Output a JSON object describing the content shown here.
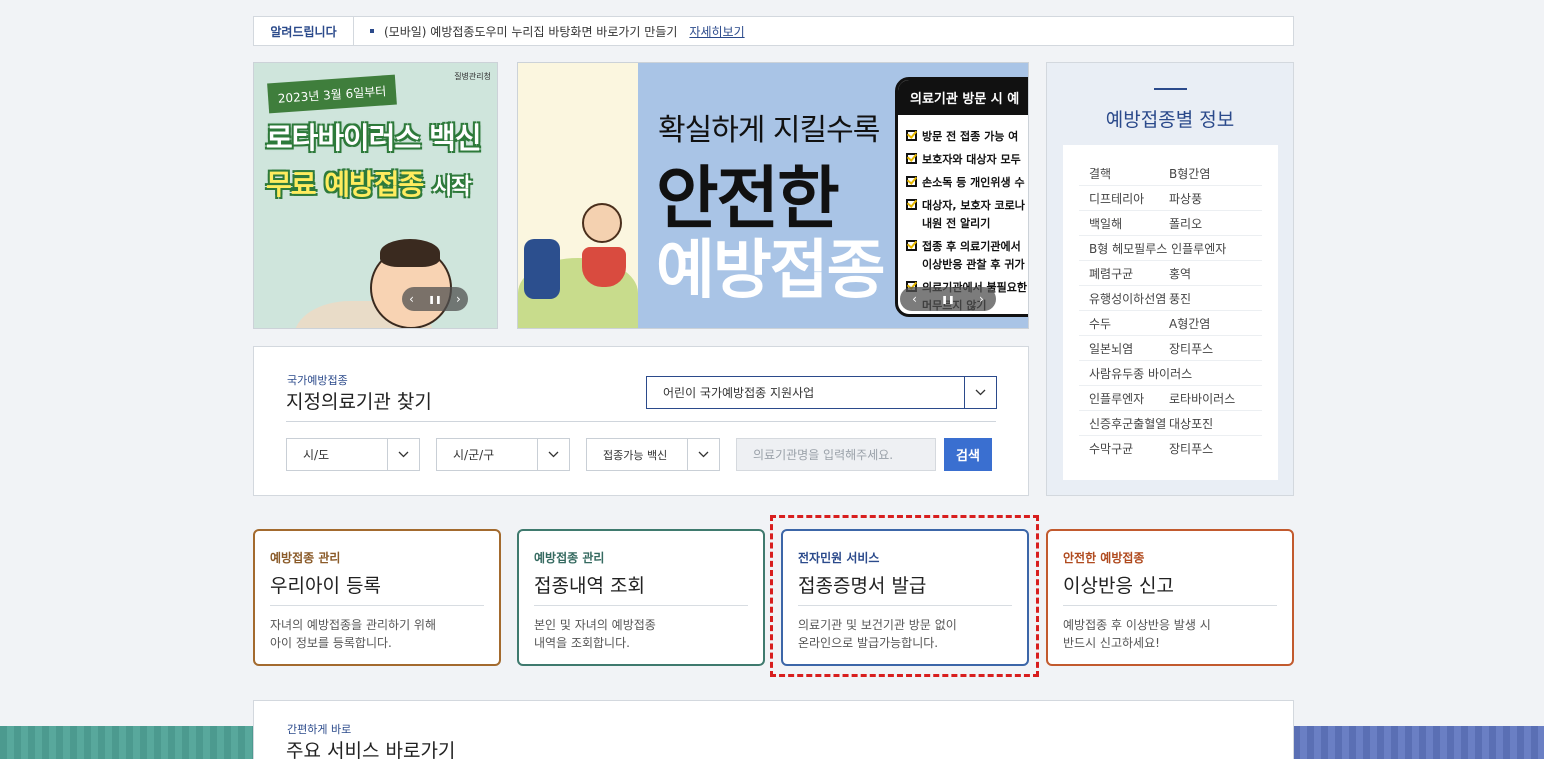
{
  "notice": {
    "label": "알려드립니다",
    "text": "(모바일) 예방접종도우미 누리집 바탕화면 바로가기 만들기",
    "link": "자세히보기"
  },
  "banner_rotavirus": {
    "date_flag": "2023년 3월 6일부터",
    "ministry": "질병관리청",
    "line1": "로타바이러스 백신",
    "line2_main": "무료 예방접종",
    "line2_tail": "시작",
    "controls": {
      "prev": "‹",
      "pause": "❚❚",
      "next": "›"
    }
  },
  "banner_safe": {
    "line1": "확실하게 지킬수록",
    "line2": "안전한",
    "line3": "예방접종",
    "panel_title": "의료기관 방문 시 예",
    "checklist": [
      "방문 전 접종 가능 여",
      "보호자와 대상자 모두",
      "손소독 등 개인위생 수",
      "대상자, 보호자 코로나",
      "내원 전 알리기",
      "접종 후 의료기관에서",
      "이상반응 관찰 후 귀가",
      "의료기관에서 불필요한",
      "머무르지 않기"
    ],
    "controls": {
      "prev": "‹",
      "pause": "❚❚",
      "next": "›"
    }
  },
  "vaccine_info": {
    "title": "예방접종별 정보",
    "rows": [
      [
        "결핵",
        "B형간염"
      ],
      [
        "디프테리아",
        "파상풍"
      ],
      [
        "백일해",
        "폴리오"
      ],
      [
        "B형 헤모필루스 인플루엔자",
        ""
      ],
      [
        "폐렴구균",
        "홍역"
      ],
      [
        "유행성이하선염",
        "풍진"
      ],
      [
        "수두",
        "A형간염"
      ],
      [
        "일본뇌염",
        "장티푸스"
      ],
      [
        "사람유두종 바이러스",
        ""
      ],
      [
        "인플루엔자",
        "로타바이러스"
      ],
      [
        "신증후군출혈열",
        "대상포진"
      ],
      [
        "수막구균",
        "장티푸스"
      ]
    ]
  },
  "search": {
    "subtitle": "국가예방접종",
    "title": "지정의료기관 찾기",
    "program_select": "어린이 국가예방접종 지원사업",
    "sido_select": "시/도",
    "sigungu_select": "시/군/구",
    "vaccine_select": "접종가능 백신",
    "input_placeholder": "의료기관명을 입력해주세요.",
    "button": "검색"
  },
  "cards": [
    {
      "category": "예방접종 관리",
      "title": "우리아이 등록",
      "desc1": "자녀의 예방접종을 관리하기 위해",
      "desc2": "아이 정보를 등록합니다."
    },
    {
      "category": "예방접종 관리",
      "title": "접종내역 조회",
      "desc1": "본인 및 자녀의 예방접종",
      "desc2": "내역을 조회합니다."
    },
    {
      "category": "전자민원 서비스",
      "title": "접종증명서 발급",
      "desc1": "의료기관 및 보건기관 방문 없이",
      "desc2": "온라인으로 발급가능합니다."
    },
    {
      "category": "안전한 예방접종",
      "title": "이상반응 신고",
      "desc1": "예방접종 후 이상반응 발생 시",
      "desc2": "반드시 신고하세요!"
    }
  ],
  "shortcuts": {
    "subtitle": "간편하게 바로",
    "title": "주요 서비스 바로가기"
  },
  "colors": {
    "primary": "#2b4a8b",
    "search_button": "#3a6fd0",
    "highlight": "#d81e1e"
  }
}
